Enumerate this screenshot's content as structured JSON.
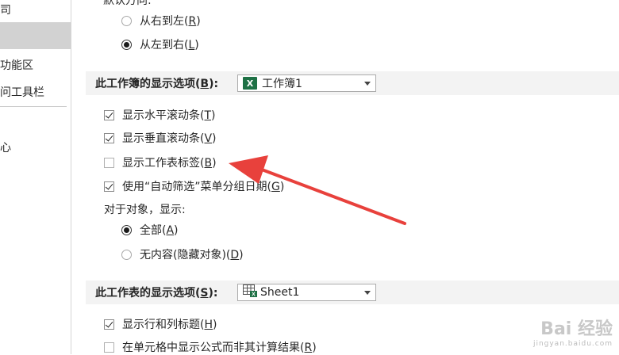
{
  "nav": {
    "items": [
      {
        "label": "司",
        "selected": false
      },
      {
        "label": "",
        "selected": true
      },
      {
        "label": "功能区",
        "selected": false
      },
      {
        "label": "问工具栏",
        "selected": false
      },
      {
        "label": "心",
        "selected": false
      }
    ]
  },
  "direction": {
    "header_partial": "默认方向:",
    "options": [
      {
        "label": "从右到左(",
        "key": "R",
        "label_end": ")",
        "selected": false
      },
      {
        "label": "从左到右(",
        "key": "L",
        "label_end": ")",
        "selected": true
      }
    ]
  },
  "workbook_section": {
    "title_prefix": "此工作簿的显示选项(",
    "title_key": "B",
    "title_suffix": "):",
    "combo_icon": "excel-icon",
    "combo_value": "工作簿1",
    "options": [
      {
        "label": "显示水平滚动条(",
        "key": "T",
        "label_end": ")",
        "checked": true
      },
      {
        "label": "显示垂直滚动条(",
        "key": "V",
        "label_end": ")",
        "checked": true
      },
      {
        "label": "显示工作表标签(",
        "key": "B",
        "label_end": ")",
        "checked": false
      },
      {
        "label": "使用“自动筛选”菜单分组日期(",
        "key": "G",
        "label_end": ")",
        "checked": true
      }
    ],
    "objects_label": "对于对象，显示:",
    "objects_options": [
      {
        "label": "全部(",
        "key": "A",
        "label_end": ")",
        "selected": true
      },
      {
        "label": "无内容(隐藏对象)(",
        "key": "D",
        "label_end": ")",
        "selected": false
      }
    ]
  },
  "worksheet_section": {
    "title_prefix": "此工作表的显示选项(",
    "title_key": "S",
    "title_suffix": "):",
    "combo_icon": "sheet-icon",
    "combo_value": "Sheet1",
    "options": [
      {
        "label": "显示行和列标题(",
        "key": "H",
        "label_end": ")",
        "checked": true
      },
      {
        "label": "在单元格中显示公式而非其计算结果(",
        "key": "R",
        "label_end": ")",
        "checked": false
      }
    ]
  },
  "annotation": {
    "color": "#e8413c"
  },
  "watermark": {
    "text": "Bai 经验",
    "url": "jingyan.baidu.com"
  },
  "colors": {
    "section_bg": "#f3f3f3",
    "nav_selected": "#d2d2d2",
    "excel_green": "#1e7145"
  }
}
